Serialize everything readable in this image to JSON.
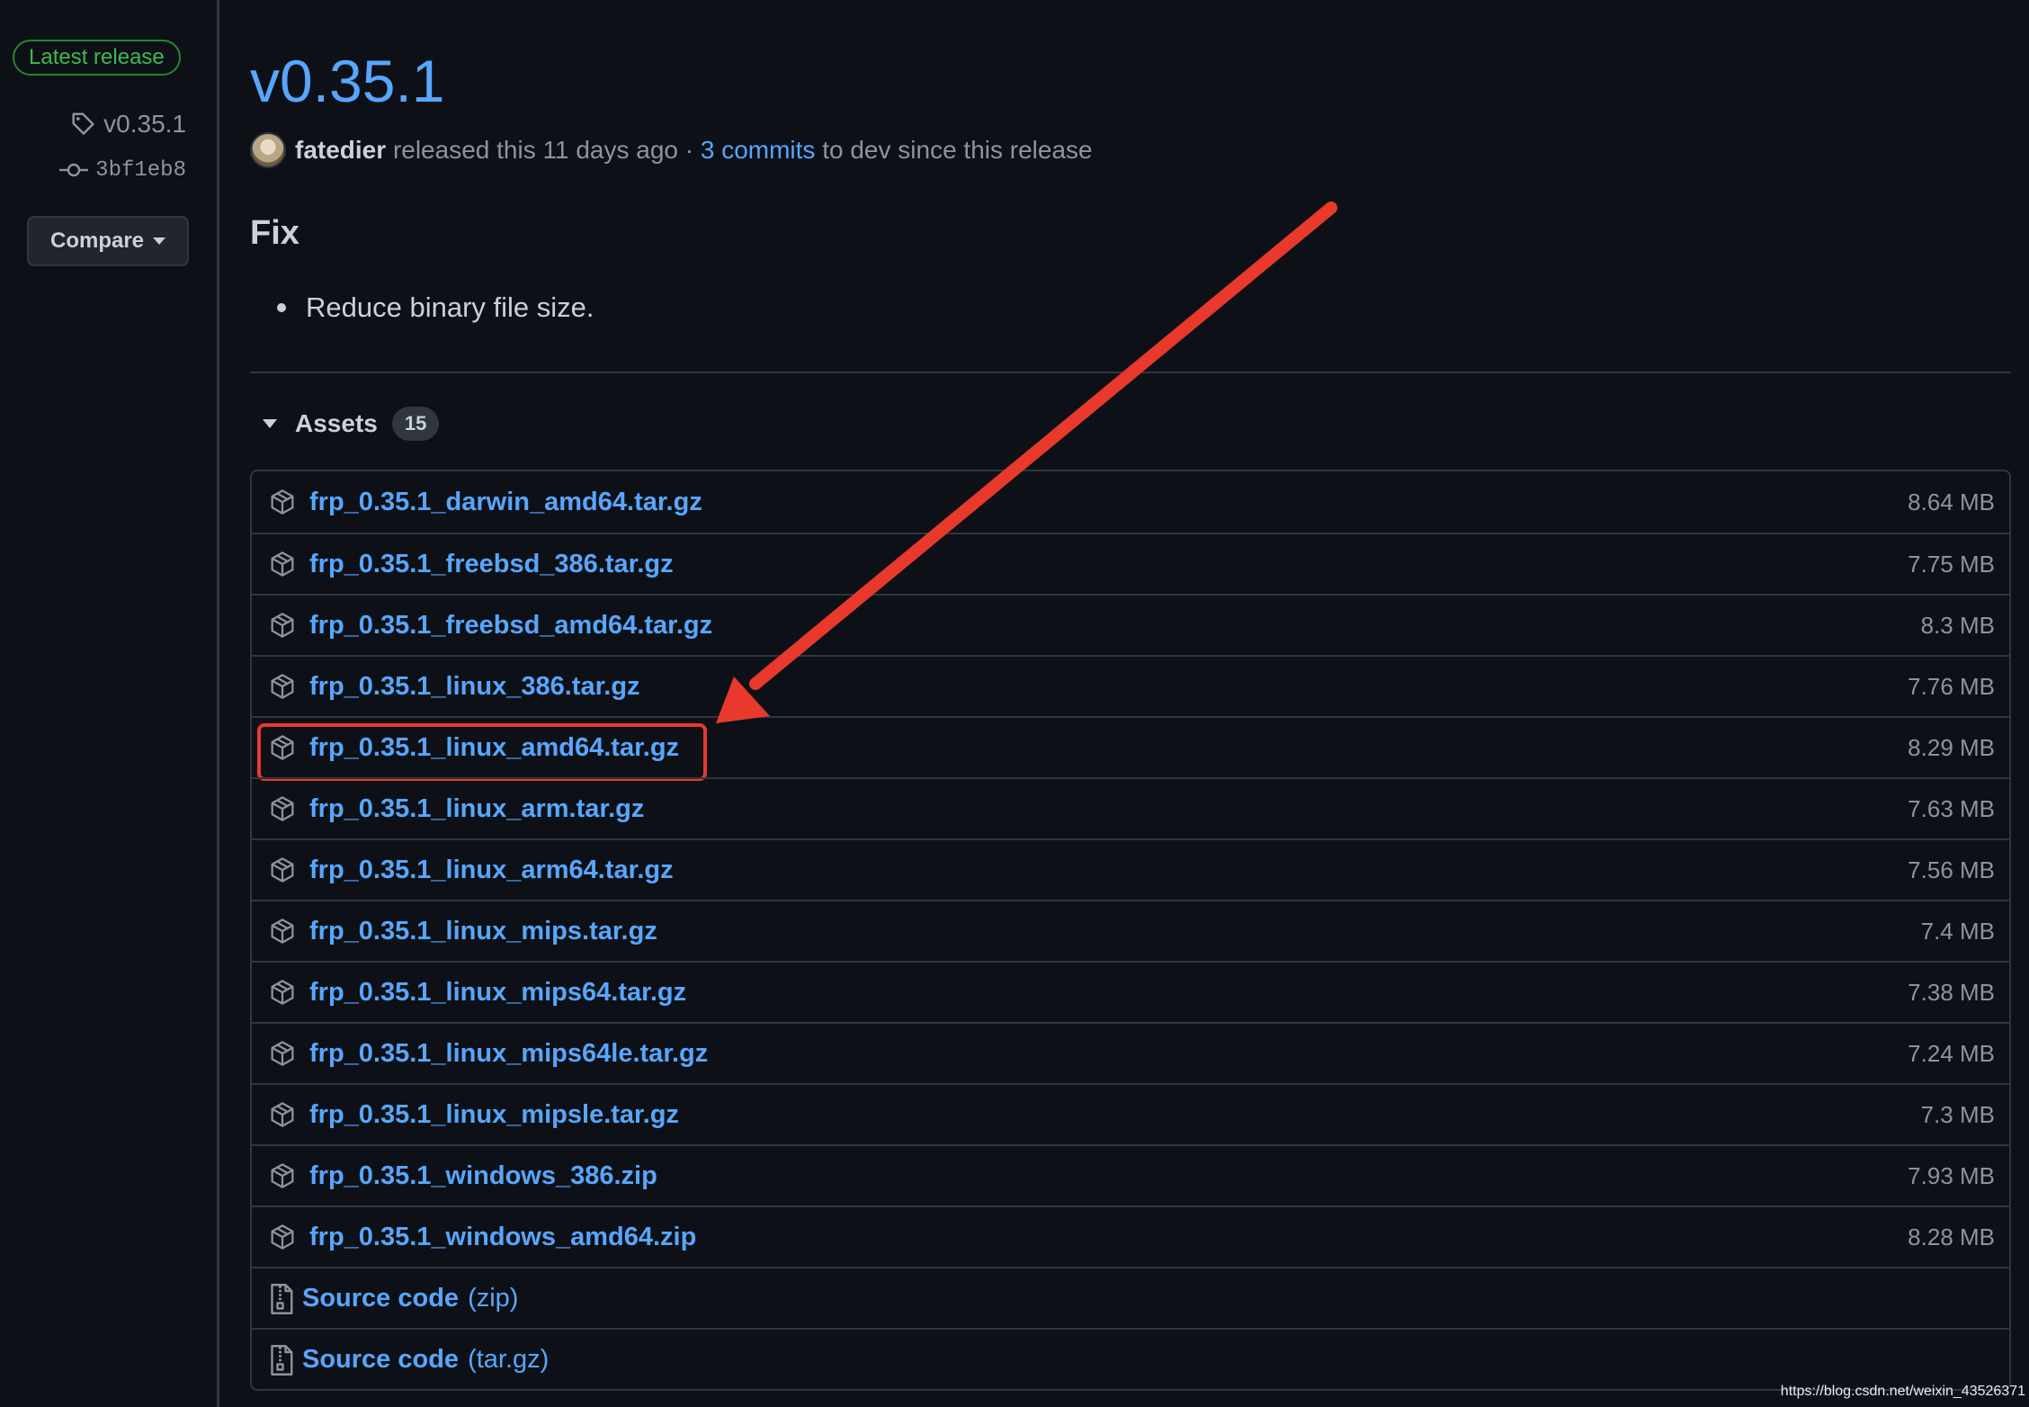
{
  "sidebar": {
    "latest_badge": "Latest release",
    "tag": "v0.35.1",
    "commit": "3bf1eb8",
    "compare_label": "Compare"
  },
  "release": {
    "title": "v0.35.1",
    "author": "fatedier",
    "released_text": "released this 11 days ago ·",
    "commits_link": "3 commits",
    "commits_suffix": "to dev since this release",
    "heading": "Fix",
    "notes": [
      "Reduce binary file size."
    ]
  },
  "assets": {
    "label": "Assets",
    "count": "15",
    "files": [
      {
        "name": "frp_0.35.1_darwin_amd64.tar.gz",
        "size": "8.64 MB"
      },
      {
        "name": "frp_0.35.1_freebsd_386.tar.gz",
        "size": "7.75 MB"
      },
      {
        "name": "frp_0.35.1_freebsd_amd64.tar.gz",
        "size": "8.3 MB"
      },
      {
        "name": "frp_0.35.1_linux_386.tar.gz",
        "size": "7.76 MB"
      },
      {
        "name": "frp_0.35.1_linux_amd64.tar.gz",
        "size": "8.29 MB"
      },
      {
        "name": "frp_0.35.1_linux_arm.tar.gz",
        "size": "7.63 MB"
      },
      {
        "name": "frp_0.35.1_linux_arm64.tar.gz",
        "size": "7.56 MB"
      },
      {
        "name": "frp_0.35.1_linux_mips.tar.gz",
        "size": "7.4 MB"
      },
      {
        "name": "frp_0.35.1_linux_mips64.tar.gz",
        "size": "7.38 MB"
      },
      {
        "name": "frp_0.35.1_linux_mips64le.tar.gz",
        "size": "7.24 MB"
      },
      {
        "name": "frp_0.35.1_linux_mipsle.tar.gz",
        "size": "7.3 MB"
      },
      {
        "name": "frp_0.35.1_windows_386.zip",
        "size": "7.93 MB"
      },
      {
        "name": "frp_0.35.1_windows_amd64.zip",
        "size": "8.28 MB"
      }
    ],
    "source": [
      {
        "label": "Source code",
        "format": "(zip)"
      },
      {
        "label": "Source code",
        "format": "(tar.gz)"
      }
    ]
  },
  "annotation": {
    "highlighted_file": "frp_0.35.1_linux_amd64.tar.gz",
    "color": "#e8392c"
  },
  "watermark": "https://blog.csdn.net/weixin_43526371",
  "colors": {
    "background": "#0d1117",
    "link": "#58a6ff",
    "muted": "#8b949e",
    "border": "#30363d",
    "badge_green": "#3fb950"
  }
}
